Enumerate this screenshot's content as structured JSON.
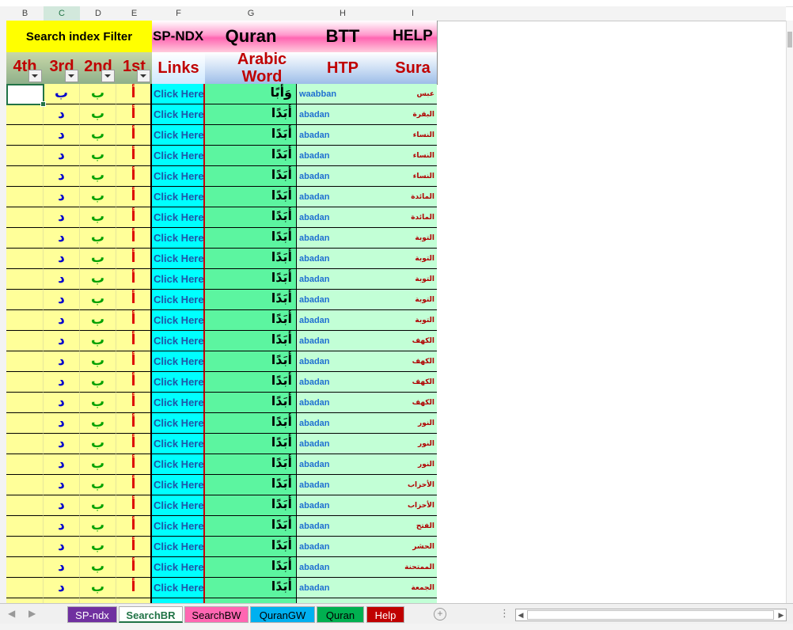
{
  "columns": [
    "B",
    "C",
    "D",
    "E",
    "F",
    "G",
    "H",
    "I"
  ],
  "header": {
    "search_filter": "Search index Filter",
    "sp_ndx": "SP-NDX",
    "quran": "Quran",
    "btt": "BTT",
    "help": "HELP",
    "col_4th": "4th",
    "col_3rd": "3rd",
    "col_2nd": "2nd",
    "col_1st": "1st",
    "links": "Links",
    "arabic_word": "Arabic Word",
    "htp": "HTP",
    "sura": "Sura"
  },
  "rows": [
    {
      "c": "ب",
      "d": "ب",
      "e": "أ",
      "f": "Click Here",
      "g": "وَأَبًا",
      "h": "waabban",
      "i": "عبس"
    },
    {
      "c": "د",
      "d": "ب",
      "e": "أ",
      "f": "Click Here",
      "g": "أَبَدًا",
      "h": "abadan",
      "i": "البقرة"
    },
    {
      "c": "د",
      "d": "ب",
      "e": "أ",
      "f": "Click Here",
      "g": "أَبَدًا",
      "h": "abadan",
      "i": "النساء"
    },
    {
      "c": "د",
      "d": "ب",
      "e": "أ",
      "f": "Click Here",
      "g": "أَبَدًا",
      "h": "abadan",
      "i": "النساء"
    },
    {
      "c": "د",
      "d": "ب",
      "e": "أ",
      "f": "Click Here",
      "g": "أَبَدًا",
      "h": "abadan",
      "i": "النساء"
    },
    {
      "c": "د",
      "d": "ب",
      "e": "أ",
      "f": "Click Here",
      "g": "أَبَدًا",
      "h": "abadan",
      "i": "المائدة"
    },
    {
      "c": "د",
      "d": "ب",
      "e": "أ",
      "f": "Click Here",
      "g": "أَبَدًا",
      "h": "abadan",
      "i": "المائدة"
    },
    {
      "c": "د",
      "d": "ب",
      "e": "أ",
      "f": "Click Here",
      "g": "أَبَدًا",
      "h": "abadan",
      "i": "التوبة"
    },
    {
      "c": "د",
      "d": "ب",
      "e": "أ",
      "f": "Click Here",
      "g": "أَبَدًا",
      "h": "abadan",
      "i": "التوبة"
    },
    {
      "c": "د",
      "d": "ب",
      "e": "أ",
      "f": "Click Here",
      "g": "أَبَدًا",
      "h": "abadan",
      "i": "التوبة"
    },
    {
      "c": "د",
      "d": "ب",
      "e": "أ",
      "f": "Click Here",
      "g": "أَبَدًا",
      "h": "abadan",
      "i": "التوبة"
    },
    {
      "c": "د",
      "d": "ب",
      "e": "أ",
      "f": "Click Here",
      "g": "أَبَدًا",
      "h": "abadan",
      "i": "التوبة"
    },
    {
      "c": "د",
      "d": "ب",
      "e": "أ",
      "f": "Click Here",
      "g": "أَبَدًا",
      "h": "abadan",
      "i": "الكهف"
    },
    {
      "c": "د",
      "d": "ب",
      "e": "أ",
      "f": "Click Here",
      "g": "أَبَدًا",
      "h": "abadan",
      "i": "الكهف"
    },
    {
      "c": "د",
      "d": "ب",
      "e": "أ",
      "f": "Click Here",
      "g": "أَبَدًا",
      "h": "abadan",
      "i": "الكهف"
    },
    {
      "c": "د",
      "d": "ب",
      "e": "أ",
      "f": "Click Here",
      "g": "أَبَدًا",
      "h": "abadan",
      "i": "الكهف"
    },
    {
      "c": "د",
      "d": "ب",
      "e": "أ",
      "f": "Click Here",
      "g": "أَبَدًا",
      "h": "abadan",
      "i": "النور"
    },
    {
      "c": "د",
      "d": "ب",
      "e": "أ",
      "f": "Click Here",
      "g": "أَبَدًا",
      "h": "abadan",
      "i": "النور"
    },
    {
      "c": "د",
      "d": "ب",
      "e": "أ",
      "f": "Click Here",
      "g": "أَبَدًا",
      "h": "abadan",
      "i": "النور"
    },
    {
      "c": "د",
      "d": "ب",
      "e": "أ",
      "f": "Click Here",
      "g": "أَبَدًا",
      "h": "abadan",
      "i": "الأحزاب"
    },
    {
      "c": "د",
      "d": "ب",
      "e": "أ",
      "f": "Click Here",
      "g": "أَبَدًا",
      "h": "abadan",
      "i": "الأحزاب"
    },
    {
      "c": "د",
      "d": "ب",
      "e": "أ",
      "f": "Click Here",
      "g": "أَبَدًا",
      "h": "abadan",
      "i": "الفتح"
    },
    {
      "c": "د",
      "d": "ب",
      "e": "أ",
      "f": "Click Here",
      "g": "أَبَدًا",
      "h": "abadan",
      "i": "الحشر"
    },
    {
      "c": "د",
      "d": "ب",
      "e": "أ",
      "f": "Click Here",
      "g": "أَبَدًا",
      "h": "abadan",
      "i": "الممتحنة"
    },
    {
      "c": "د",
      "d": "ب",
      "e": "أ",
      "f": "Click Here",
      "g": "أَبَدًا",
      "h": "abadan",
      "i": "الجمعة"
    },
    {
      "c": "",
      "d": "",
      "e": "",
      "f": "",
      "g": "",
      "h": "",
      "i": ""
    }
  ],
  "sheet_tabs": [
    {
      "label": "SP-ndx",
      "bg": "#7030a0",
      "fg": "#ffffff",
      "active": false
    },
    {
      "label": "SearchBR",
      "bg": "#ffffff",
      "fg": "#217346",
      "active": true
    },
    {
      "label": "SearchBW",
      "bg": "#ff66b2",
      "fg": "#000000",
      "active": false
    },
    {
      "label": "QuranGW",
      "bg": "#00b0f0",
      "fg": "#000000",
      "active": false
    },
    {
      "label": "Quran",
      "bg": "#00b050",
      "fg": "#000000",
      "active": false
    },
    {
      "label": "Help",
      "bg": "#c00000",
      "fg": "#ffffff",
      "active": false
    }
  ],
  "colors": {
    "selected_header": "#217346",
    "yellow_header": "#ffff00",
    "filter_col_bg": "#ffff99",
    "links_col_bg": "#00ffff",
    "arabic_col_bg": "#5cf5a0",
    "htp_col_bg": "#c2ffd6"
  }
}
